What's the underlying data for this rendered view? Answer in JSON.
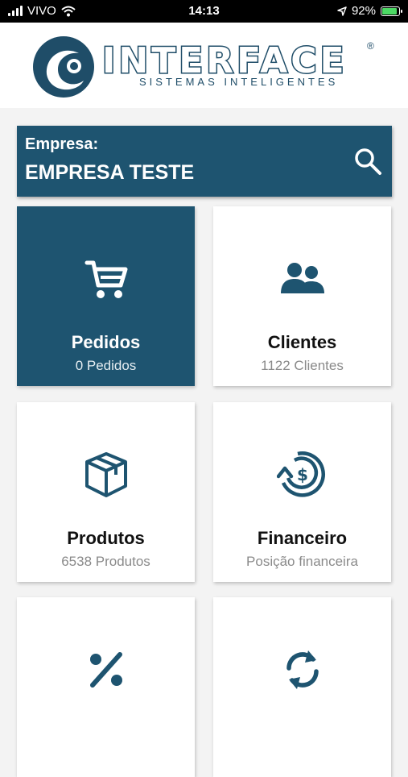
{
  "status_bar": {
    "carrier": "VIVO",
    "time": "14:13",
    "battery": "92%"
  },
  "header": {
    "brand_name": "INTERFACE",
    "registered": "®",
    "tagline": "SISTEMAS INTELIGENTES"
  },
  "company": {
    "label": "Empresa:",
    "value": "EMPRESA TESTE"
  },
  "cards": [
    {
      "title": "Pedidos",
      "subtitle": "0 Pedidos",
      "icon": "cart-icon"
    },
    {
      "title": "Clientes",
      "subtitle": "1122 Clientes",
      "icon": "users-icon"
    },
    {
      "title": "Produtos",
      "subtitle": "6538 Produtos",
      "icon": "box-icon"
    },
    {
      "title": "Financeiro",
      "subtitle": "Posição financeira",
      "icon": "money-icon"
    },
    {
      "title": "",
      "subtitle": "",
      "icon": "percent-icon"
    },
    {
      "title": "",
      "subtitle": "",
      "icon": "sync-icon"
    }
  ],
  "colors": {
    "primary": "#1e5470",
    "background": "#f3f3f3",
    "subtitle": "#8a8a8a"
  }
}
